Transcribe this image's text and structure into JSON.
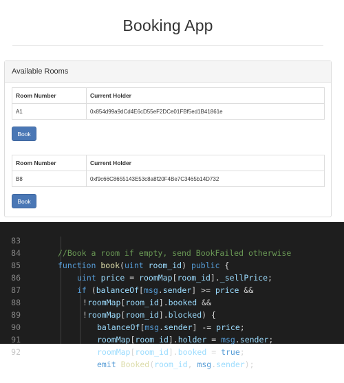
{
  "app": {
    "title": "Booking App",
    "panel_title": "Available Rooms",
    "columns": [
      "Room Number",
      "Current Holder"
    ],
    "rooms": [
      {
        "number": "A1",
        "holder": "0x854d99a9dCd4E6cD55eF2DCe01FBf5ed1B41861e",
        "button": "Book"
      },
      {
        "number": "B8",
        "holder": "0xf9c66C8655143E53c8a8f20F4Be7C3465b14D732",
        "button": "Book"
      }
    ]
  },
  "editor": {
    "active_line": "92",
    "lines": [
      {
        "n": "83",
        "text": "//Book a room if empty, send BookFailed otherwise"
      },
      {
        "n": "84",
        "text": "function book(uint room_id) public {"
      },
      {
        "n": "85",
        "text": "uint price = roomMap[room_id]._sellPrice;"
      },
      {
        "n": "86",
        "text": "if (balanceOf[msg.sender] >= price &&"
      },
      {
        "n": "87",
        "text": "!roomMap[room_id].booked &&"
      },
      {
        "n": "88",
        "text": "!roomMap[room_id].blocked) {"
      },
      {
        "n": "89",
        "text": "balanceOf[msg.sender] -= price;"
      },
      {
        "n": "90",
        "text": "roomMap[room_id].holder = msg.sender;"
      },
      {
        "n": "91",
        "text": "roomMap[room_id].booked = true;"
      },
      {
        "n": "92",
        "text": "emit Booked(room_id, msg.sender);"
      }
    ]
  }
}
